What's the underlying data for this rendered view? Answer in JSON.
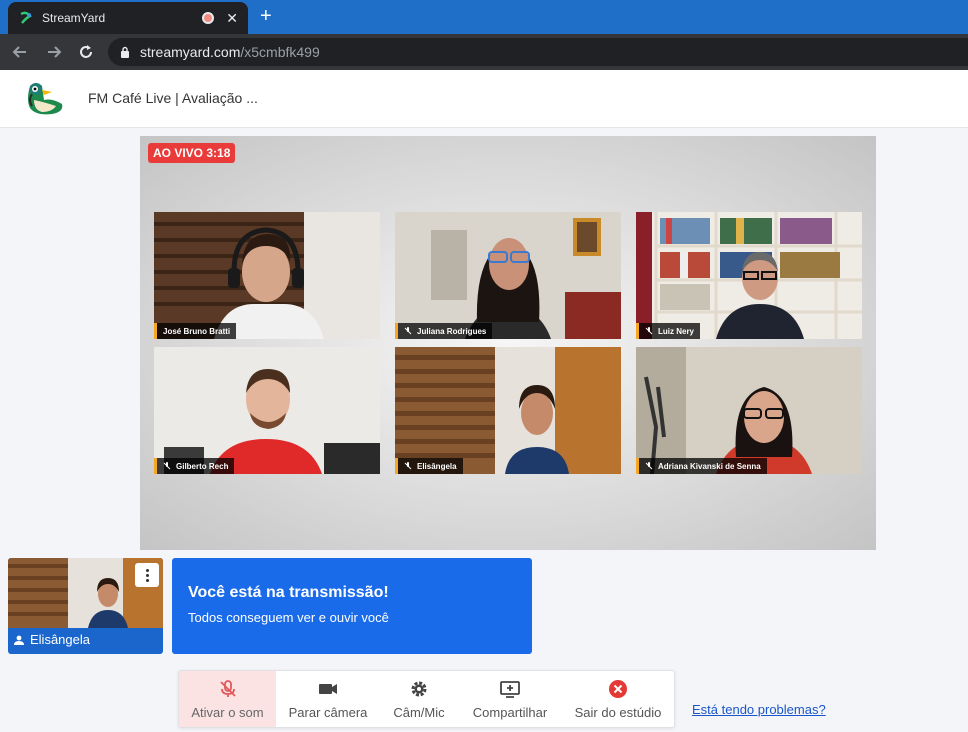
{
  "browser": {
    "tab_title": "StreamYard",
    "tab_close": "✕",
    "new_tab": "+",
    "url_host": "streamyard.com",
    "url_path": "/x5cmbfk499"
  },
  "header": {
    "broadcast_title": "FM Café Live | Avaliação ..."
  },
  "stage": {
    "live_label": "AO VIVO 3:18",
    "participants": [
      {
        "name": "José Bruno Bratti",
        "muted": false
      },
      {
        "name": "Juliana Rodrigues",
        "muted": true
      },
      {
        "name": "Luiz Nery",
        "muted": true
      },
      {
        "name": "Gilberto Rech",
        "muted": true
      },
      {
        "name": "Elisângela",
        "muted": true
      },
      {
        "name": "Adriana Kivanski de Senna",
        "muted": true
      }
    ]
  },
  "self_view": {
    "name": "Elisângela"
  },
  "banner": {
    "title": "Você está na transmissão!",
    "subtitle": "Todos conseguem ver e ouvir você"
  },
  "toolbar": {
    "unmute_label": "Ativar o som",
    "stop_camera_label": "Parar câmera",
    "cam_mic_label": "Câm/Mic",
    "share_label": "Compartilhar",
    "leave_label": "Sair do estúdio"
  },
  "help": {
    "link_label": "Está tendo problemas?"
  },
  "colors": {
    "live_red": "#ea3b3b",
    "brand_blue": "#1a6bea",
    "nameplate_accent": "#f5a623",
    "leave_red": "#e53935"
  }
}
